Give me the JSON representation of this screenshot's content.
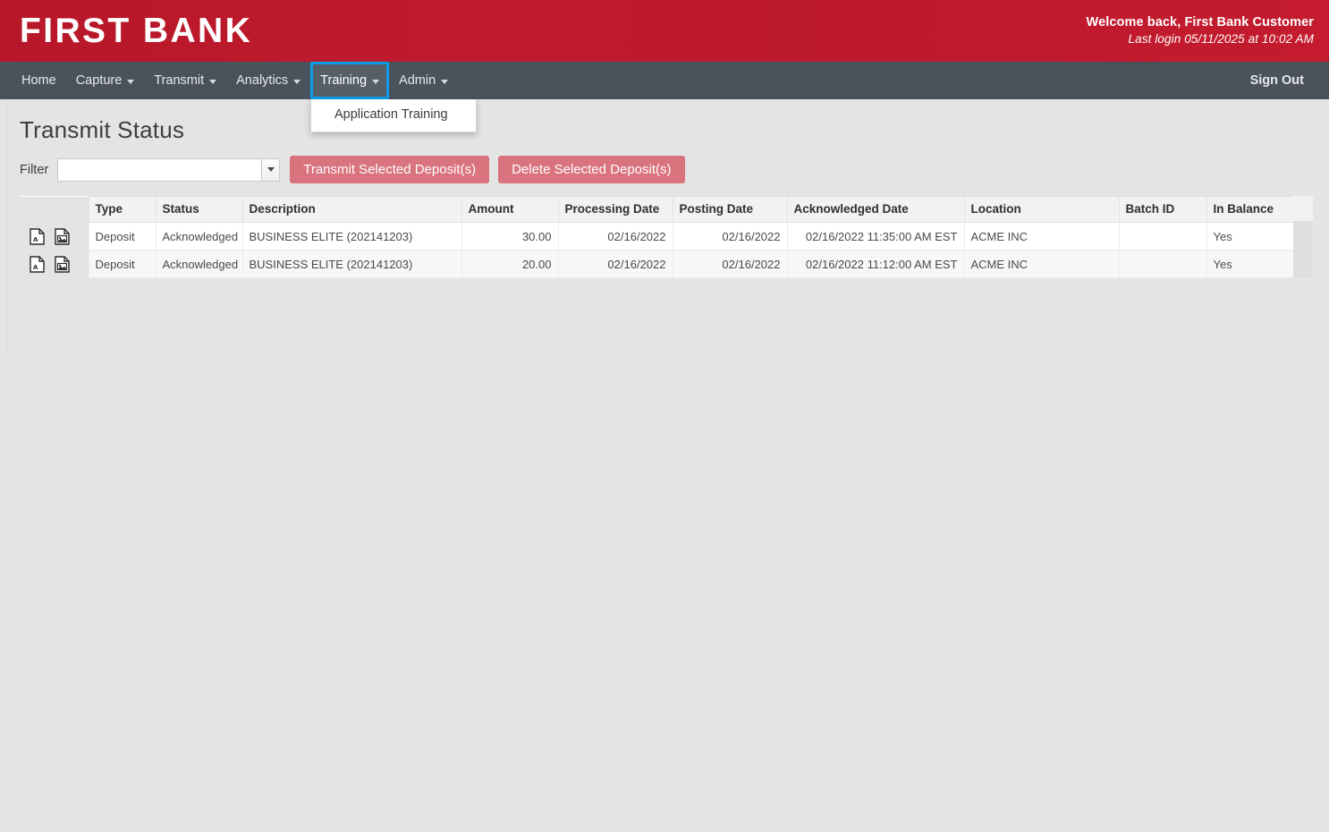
{
  "brand": {
    "name": "FIRST BANK",
    "welcome": "Welcome back, First Bank Customer",
    "last_login": "Last login 05/11/2025 at 10:02 AM",
    "brand_color": "#bd1a2c"
  },
  "nav": {
    "items": [
      {
        "label": "Home",
        "has_caret": false,
        "active": false
      },
      {
        "label": "Capture",
        "has_caret": true,
        "active": false
      },
      {
        "label": "Transmit",
        "has_caret": true,
        "active": false
      },
      {
        "label": "Analytics",
        "has_caret": true,
        "active": false
      },
      {
        "label": "Training",
        "has_caret": true,
        "active": true
      },
      {
        "label": "Admin",
        "has_caret": true,
        "active": false
      }
    ],
    "sign_out": "Sign Out",
    "focus_color": "#0d9ce8",
    "dropdown": {
      "owner": "Training",
      "items": [
        "Application Training"
      ]
    }
  },
  "page": {
    "title": "Transmit Status",
    "filter_label": "Filter",
    "filter_value": "",
    "filter_placeholder": "",
    "buttons": {
      "transmit": "Transmit Selected Deposit(s)",
      "delete": "Delete Selected Deposit(s)",
      "color": "#d9737d"
    }
  },
  "table": {
    "columns": [
      "",
      "Type",
      "Status",
      "Description",
      "Amount",
      "Processing Date",
      "Posting Date",
      "Acknowledged Date",
      "Location",
      "Batch ID",
      "In Balance"
    ],
    "rows": [
      {
        "icons": [
          "pdf-document-icon",
          "image-document-icon"
        ],
        "type": "Deposit",
        "status": "Acknowledged",
        "description": "BUSINESS ELITE (202141203)",
        "amount": "30.00",
        "processing_date": "02/16/2022",
        "posting_date": "02/16/2022",
        "acknowledged_date": "02/16/2022 11:35:00 AM EST",
        "location": "ACME INC",
        "batch_id": "",
        "in_balance": "Yes"
      },
      {
        "icons": [
          "pdf-document-icon",
          "image-document-icon"
        ],
        "type": "Deposit",
        "status": "Acknowledged",
        "description": "BUSINESS ELITE (202141203)",
        "amount": "20.00",
        "processing_date": "02/16/2022",
        "posting_date": "02/16/2022",
        "acknowledged_date": "02/16/2022 11:12:00 AM EST",
        "location": "ACME INC",
        "batch_id": "",
        "in_balance": "Yes"
      }
    ]
  }
}
